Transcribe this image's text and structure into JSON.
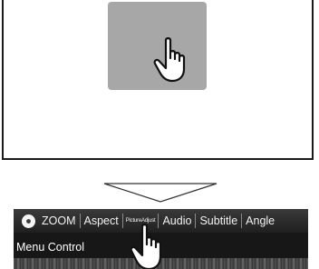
{
  "top_screen": {
    "touch_icon": "pointing-hand-icon"
  },
  "arrow_icon": "down-arrow-icon",
  "player": {
    "disc_icon": "disc-icon",
    "menu_items": [
      {
        "label": "ZOOM"
      },
      {
        "label": "Aspect"
      },
      {
        "label": "PictureAdjust"
      },
      {
        "label": "Audio"
      },
      {
        "label": "Subtitle"
      },
      {
        "label": "Angle"
      }
    ],
    "menu_control_label": "Menu Control",
    "touch_icon": "pointing-hand-icon"
  },
  "colors": {
    "touch_area": "#a7a7a7",
    "player_bg": "#171717"
  }
}
